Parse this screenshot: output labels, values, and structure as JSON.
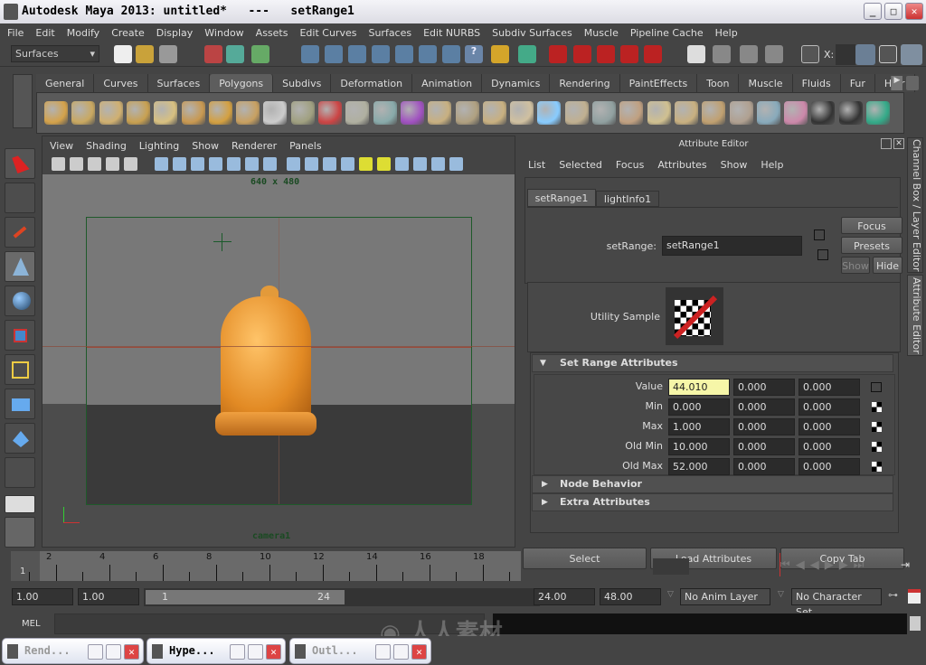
{
  "window": {
    "title": "Autodesk Maya 2013: untitled*   ---   setRange1",
    "buttons": [
      "minimize",
      "maximize",
      "close"
    ]
  },
  "menubar": [
    "File",
    "Edit",
    "Modify",
    "Create",
    "Display",
    "Window",
    "Assets",
    "Edit Curves",
    "Surfaces",
    "Edit NURBS",
    "Subdiv Surfaces",
    "Muscle",
    "Pipeline Cache",
    "Help"
  ],
  "statusline": {
    "menuset": "Surfaces",
    "x_label": "X:"
  },
  "shelf": {
    "tabs": [
      "General",
      "Curves",
      "Surfaces",
      "Polygons",
      "Subdivs",
      "Deformation",
      "Animation",
      "Dynamics",
      "Rendering",
      "PaintEffects",
      "Toon",
      "Muscle",
      "Fluids",
      "Fur",
      "Hair"
    ],
    "active_tab": "Polygons",
    "icons": [
      "poly-sphere-icon",
      "poly-cube-icon",
      "poly-cylinder-icon",
      "poly-cone-icon",
      "poly-plane-icon",
      "poly-torus-icon",
      "poly-pyramid-icon",
      "poly-pipe-icon",
      "soccer-ball-icon",
      "combine-icon",
      "separate-icon",
      "extract-icon",
      "smooth-icon",
      "boolean-icon",
      "extrude-icon",
      "bridge-icon",
      "append-icon",
      "split-icon",
      "insert-edge-loop-icon",
      "offset-edge-loop-icon",
      "wedge-icon",
      "duplicate-face-icon",
      "merge-icon",
      "collapse-icon",
      "bevel-icon",
      "triangulate-icon",
      "quadrangulate-icon",
      "sculpt-icon",
      "uv-checker-icon",
      "uv-layout-icon",
      "uv-editor-icon"
    ]
  },
  "viewport": {
    "menu": [
      "View",
      "Shading",
      "Lighting",
      "Show",
      "Renderer",
      "Panels"
    ],
    "resolution": "640 x 480",
    "camera": "camera1"
  },
  "attribute_editor": {
    "title": "Attribute Editor",
    "menu": [
      "List",
      "Selected",
      "Focus",
      "Attributes",
      "Show",
      "Help"
    ],
    "tabs": [
      "setRange1",
      "lightInfo1"
    ],
    "node_label": "setRange:",
    "node_name": "setRange1",
    "buttons": {
      "focus": "Focus",
      "presets": "Presets",
      "show": "Show",
      "hide": "Hide"
    },
    "swatch_label": "Utility Sample",
    "sections": {
      "set_range": "Set Range Attributes",
      "node_behavior": "Node Behavior",
      "extra": "Extra Attributes"
    },
    "rows": [
      {
        "label": "Value",
        "values": [
          "44.010",
          "0.000",
          "0.000"
        ]
      },
      {
        "label": "Min",
        "values": [
          "0.000",
          "0.000",
          "0.000"
        ]
      },
      {
        "label": "Max",
        "values": [
          "1.000",
          "0.000",
          "0.000"
        ]
      },
      {
        "label": "Old Min",
        "values": [
          "10.000",
          "0.000",
          "0.000"
        ]
      },
      {
        "label": "Old Max",
        "values": [
          "52.000",
          "0.000",
          "0.000"
        ]
      }
    ],
    "footer": {
      "select": "Select",
      "load": "Load Attributes",
      "copy": "Copy Tab"
    },
    "side_tabs": {
      "channel_box": "Channel Box / Layer Editor",
      "attribute_editor": "Attribute Editor"
    }
  },
  "timeslider": {
    "ticks": [
      "2",
      "4",
      "6",
      "8",
      "10",
      "12",
      "14",
      "16",
      "18"
    ],
    "current": "1"
  },
  "range": {
    "start": "1.00",
    "playback_start": "1.00",
    "slider_start": "1",
    "slider_end": "24",
    "playback_end": "24.00",
    "end": "48.00",
    "anim_layer": "No Anim Layer",
    "character_set": "No Character Set"
  },
  "commandline": {
    "label": "MEL"
  },
  "minimized_windows": [
    "Rend...",
    "Hype...",
    "Outl..."
  ],
  "watermark": "人人素材"
}
